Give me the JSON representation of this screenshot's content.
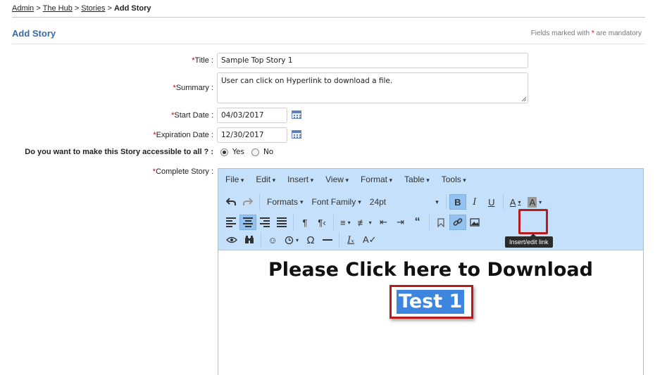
{
  "breadcrumb": {
    "items": [
      "Admin",
      "The Hub",
      "Stories"
    ],
    "separator": ">",
    "current": "Add Story"
  },
  "page": {
    "title": "Add Story",
    "mandatory_prefix": "Fields marked with",
    "mandatory_star": "*",
    "mandatory_suffix": "are mandatory"
  },
  "form": {
    "required_marker": "*",
    "title_label": "Title :",
    "title_value": "Sample Top Story 1",
    "summary_label": "Summary :",
    "summary_value": "User can click on Hyperlink to download a file.",
    "start_date_label": "Start Date :",
    "start_date_value": "04/03/2017",
    "expiration_date_label": "Expiration Date :",
    "expiration_date_value": "12/30/2017",
    "accessible_label": "Do you want to make this Story accessible to all ? :",
    "accessible_options": [
      "Yes",
      "No"
    ],
    "accessible_selected": "Yes",
    "complete_story_label": "Complete Story :"
  },
  "editor": {
    "menu": [
      "File",
      "Edit",
      "Insert",
      "View",
      "Format",
      "Table",
      "Tools"
    ],
    "formats_label": "Formats",
    "font_family_label": "Font Family",
    "font_size_label": "24pt",
    "bold_label": "B",
    "italic_label": "I",
    "underline_label": "U",
    "text_color_label": "A",
    "bg_color_label": "A",
    "tooltip": "Insert/edit link",
    "content_heading": "Please Click here to Download",
    "selected_text": "Test 1",
    "icons": {
      "undo": "undo-icon",
      "redo": "redo-icon",
      "align_left": "align-left-icon",
      "align_center": "align-center-icon",
      "align_right": "align-right-icon",
      "align_justify": "align-justify-icon",
      "ltr": "ltr-icon",
      "rtl": "rtl-icon",
      "bullet_list": "bullet-list-icon",
      "numbered_list": "numbered-list-icon",
      "outdent": "outdent-icon",
      "indent": "indent-icon",
      "blockquote": "blockquote-icon",
      "anchor": "bookmark-icon",
      "link": "link-icon",
      "image": "image-icon",
      "preview": "eye-icon",
      "find": "binoculars-icon",
      "emoticons": "smiley-icon",
      "datetime": "clock-icon",
      "special_char": "omega-icon",
      "hr": "horizontal-rule-icon",
      "clear_format": "clear-formatting-icon",
      "spellcheck": "spellcheck-icon"
    }
  },
  "colors": {
    "accent": "#3b6aa3",
    "required": "#cc0000",
    "toolbar_bg": "#c5e0fa",
    "selection": "#3d86e0",
    "highlight_box": "#b71c1c"
  }
}
